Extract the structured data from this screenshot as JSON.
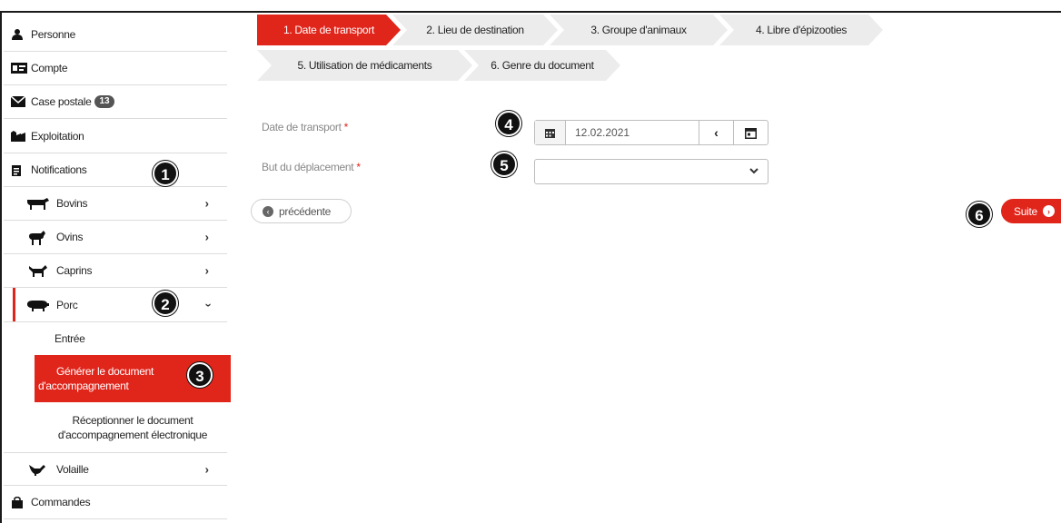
{
  "sidebar": {
    "items": [
      {
        "label": "Personne",
        "icon": "person-icon"
      },
      {
        "label": "Compte",
        "icon": "id-card-icon"
      },
      {
        "label": "Case postale",
        "icon": "envelope-icon",
        "badge": "13"
      },
      {
        "label": "Exploitation",
        "icon": "farm-icon"
      },
      {
        "label": "Notifications",
        "icon": "clipboard-icon"
      },
      {
        "label": "Bovins",
        "icon": "cow-icon"
      },
      {
        "label": "Ovins",
        "icon": "sheep-icon"
      },
      {
        "label": "Caprins",
        "icon": "goat-icon"
      },
      {
        "label": "Porc",
        "icon": "pig-icon"
      },
      {
        "label": "Volaille",
        "icon": "chicken-icon"
      },
      {
        "label": "Commandes",
        "icon": "bag-icon"
      }
    ],
    "porc_sub": {
      "entree": "Entrée",
      "generer_line1": "Générer le document",
      "generer_line2": "d'accompagnement",
      "receptionner_line1": "Réceptionner le document",
      "receptionner_line2": "d'accompagnement électronique"
    }
  },
  "callouts": [
    "1",
    "2",
    "3",
    "4",
    "5",
    "6"
  ],
  "steps": [
    {
      "label": "1. Date de transport",
      "active": true
    },
    {
      "label": "2. Lieu de destination",
      "active": false
    },
    {
      "label": "3. Groupe d'animaux",
      "active": false
    },
    {
      "label": "4. Libre d'épizooties",
      "active": false
    },
    {
      "label": "5. Utilisation de médicaments",
      "active": false
    },
    {
      "label": "6. Genre du document",
      "active": false
    }
  ],
  "form": {
    "date_label": "Date de transport",
    "date_value": "12.02.2021",
    "purpose_label": "But du déplacement",
    "purpose_value": "",
    "required_mark": "*"
  },
  "buttons": {
    "previous": "précédente",
    "next": "Suite"
  },
  "colors": {
    "accent": "#e0251b",
    "step_inactive": "#ececec"
  }
}
